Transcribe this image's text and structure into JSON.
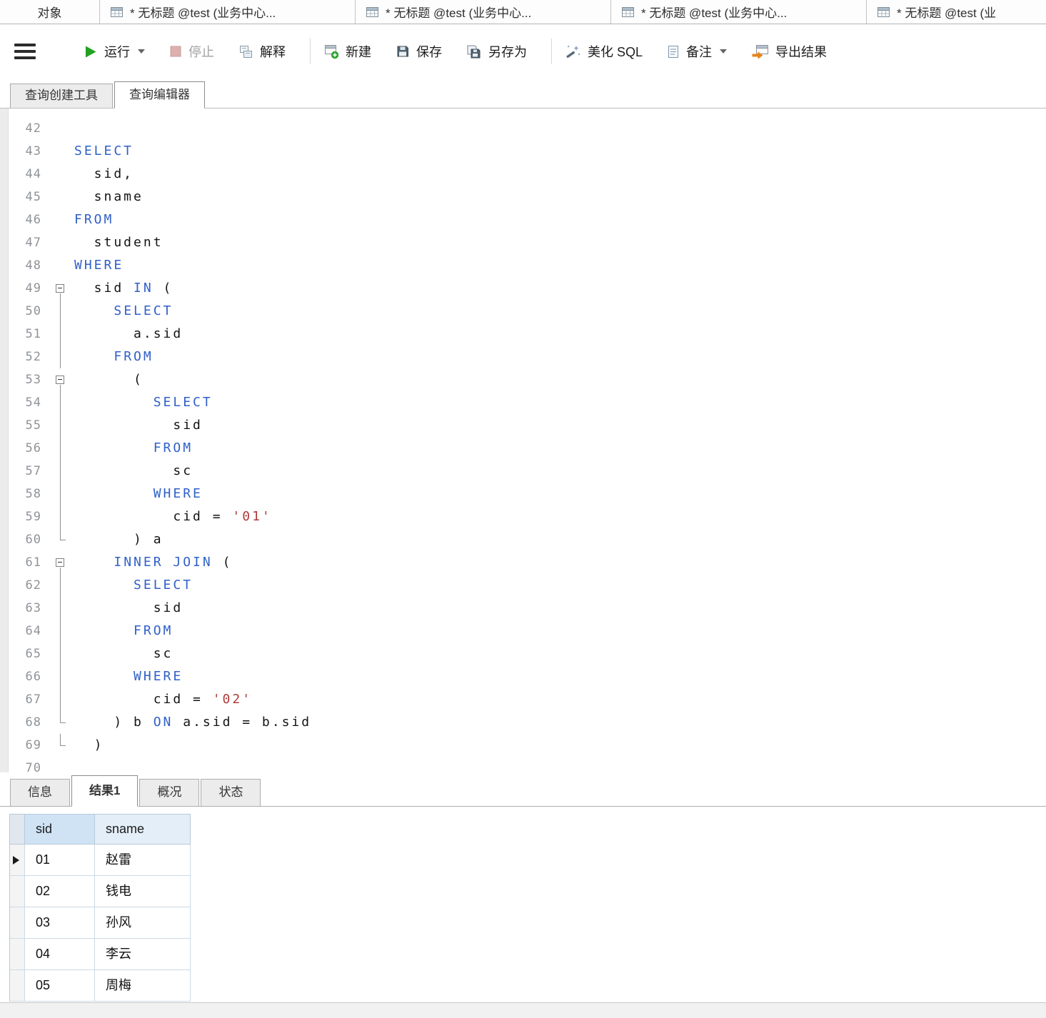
{
  "doc_tabs": [
    {
      "label": "对象"
    },
    {
      "label": "* 无标题 @test (业务中心..."
    },
    {
      "label": "* 无标题 @test (业务中心..."
    },
    {
      "label": "* 无标题 @test (业务中心..."
    },
    {
      "label": "* 无标题 @test (业"
    }
  ],
  "toolbar": {
    "run": "运行",
    "stop": "停止",
    "explain": "解释",
    "new": "新建",
    "save": "保存",
    "save_as": "另存为",
    "beautify": "美化 SQL",
    "comment": "备注",
    "export": "导出结果"
  },
  "editor_tabs": [
    {
      "label": "查询创建工具",
      "active": false
    },
    {
      "label": "查询编辑器",
      "active": true
    }
  ],
  "editor": {
    "lines": [
      {
        "n": 42,
        "fold": "",
        "seg": []
      },
      {
        "n": 43,
        "fold": "",
        "seg": [
          [
            "kw",
            "SELECT"
          ]
        ]
      },
      {
        "n": 44,
        "fold": "",
        "seg": [
          [
            "pl",
            "  sid,"
          ]
        ]
      },
      {
        "n": 45,
        "fold": "",
        "seg": [
          [
            "pl",
            "  sname"
          ]
        ]
      },
      {
        "n": 46,
        "fold": "",
        "seg": [
          [
            "kw",
            "FROM"
          ]
        ]
      },
      {
        "n": 47,
        "fold": "",
        "seg": [
          [
            "pl",
            "  student"
          ]
        ]
      },
      {
        "n": 48,
        "fold": "",
        "seg": [
          [
            "kw",
            "WHERE"
          ]
        ]
      },
      {
        "n": 49,
        "fold": "box",
        "seg": [
          [
            "pl",
            "  sid "
          ],
          [
            "kw",
            "IN"
          ],
          [
            "pl",
            " ("
          ]
        ]
      },
      {
        "n": 50,
        "fold": "line",
        "seg": [
          [
            "pl",
            "    "
          ],
          [
            "kw",
            "SELECT"
          ]
        ]
      },
      {
        "n": 51,
        "fold": "line",
        "seg": [
          [
            "pl",
            "      a.sid"
          ]
        ]
      },
      {
        "n": 52,
        "fold": "line",
        "seg": [
          [
            "pl",
            "    "
          ],
          [
            "kw",
            "FROM"
          ]
        ]
      },
      {
        "n": 53,
        "fold": "box",
        "seg": [
          [
            "pl",
            "      ("
          ]
        ]
      },
      {
        "n": 54,
        "fold": "line",
        "seg": [
          [
            "pl",
            "        "
          ],
          [
            "kw",
            "SELECT"
          ]
        ]
      },
      {
        "n": 55,
        "fold": "line",
        "seg": [
          [
            "pl",
            "          sid"
          ]
        ]
      },
      {
        "n": 56,
        "fold": "line",
        "seg": [
          [
            "pl",
            "        "
          ],
          [
            "kw",
            "FROM"
          ]
        ]
      },
      {
        "n": 57,
        "fold": "line",
        "seg": [
          [
            "pl",
            "          sc"
          ]
        ]
      },
      {
        "n": 58,
        "fold": "line",
        "seg": [
          [
            "pl",
            "        "
          ],
          [
            "kw",
            "WHERE"
          ]
        ]
      },
      {
        "n": 59,
        "fold": "line",
        "seg": [
          [
            "pl",
            "          cid = "
          ],
          [
            "str",
            "'01'"
          ]
        ]
      },
      {
        "n": 60,
        "fold": "end",
        "seg": [
          [
            "pl",
            "      ) a"
          ]
        ]
      },
      {
        "n": 61,
        "fold": "box",
        "seg": [
          [
            "pl",
            "    "
          ],
          [
            "kw",
            "INNER JOIN"
          ],
          [
            "pl",
            " ("
          ]
        ]
      },
      {
        "n": 62,
        "fold": "line",
        "seg": [
          [
            "pl",
            "      "
          ],
          [
            "kw",
            "SELECT"
          ]
        ]
      },
      {
        "n": 63,
        "fold": "line",
        "seg": [
          [
            "pl",
            "        sid"
          ]
        ]
      },
      {
        "n": 64,
        "fold": "line",
        "seg": [
          [
            "pl",
            "      "
          ],
          [
            "kw",
            "FROM"
          ]
        ]
      },
      {
        "n": 65,
        "fold": "line",
        "seg": [
          [
            "pl",
            "        sc"
          ]
        ]
      },
      {
        "n": 66,
        "fold": "line",
        "seg": [
          [
            "pl",
            "      "
          ],
          [
            "kw",
            "WHERE"
          ]
        ]
      },
      {
        "n": 67,
        "fold": "line",
        "seg": [
          [
            "pl",
            "        cid = "
          ],
          [
            "str",
            "'02'"
          ]
        ]
      },
      {
        "n": 68,
        "fold": "end",
        "seg": [
          [
            "pl",
            "    ) b "
          ],
          [
            "kw",
            "ON"
          ],
          [
            "pl",
            " a.sid = b.sid"
          ]
        ]
      },
      {
        "n": 69,
        "fold": "end",
        "seg": [
          [
            "pl",
            "  )"
          ]
        ]
      },
      {
        "n": 70,
        "fold": "",
        "seg": []
      }
    ]
  },
  "result_tabs": [
    "信息",
    "结果1",
    "概况",
    "状态"
  ],
  "grid": {
    "columns": [
      "sid",
      "sname"
    ],
    "rows": [
      [
        "01",
        "赵雷"
      ],
      [
        "02",
        "钱电"
      ],
      [
        "03",
        "孙风"
      ],
      [
        "04",
        "李云"
      ],
      [
        "05",
        "周梅"
      ]
    ]
  },
  "colors": {
    "keyword_blue": "#3060c8",
    "string_red": "#b03a3a",
    "run_green": "#21a121",
    "export_orange": "#e8841e",
    "header_blue": "#cfe3f5"
  }
}
